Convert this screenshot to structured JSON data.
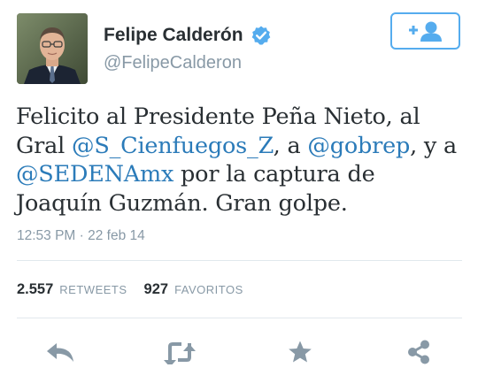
{
  "user": {
    "display_name": "Felipe Calderón",
    "handle": "@FelipeCalderon",
    "verified_icon": "verified-badge-icon"
  },
  "follow_button": {
    "icon": "add-user-icon",
    "label": "+"
  },
  "tweet": {
    "segments": [
      {
        "type": "text",
        "value": "Felicito al Presidente Peña Nieto, al Gral "
      },
      {
        "type": "mention",
        "value": "@S_Cienfuegos_Z"
      },
      {
        "type": "text",
        "value": ", a "
      },
      {
        "type": "mention",
        "value": "@gobrep"
      },
      {
        "type": "text",
        "value": ", y a "
      },
      {
        "type": "mention",
        "value": "@SEDENAmx"
      },
      {
        "type": "text",
        "value": " por la captura de Joaquín Guzmán. Gran golpe."
      }
    ],
    "timestamp": "12:53 PM · 22 feb 14"
  },
  "stats": {
    "retweets_count": "2.557",
    "retweets_label": "RETWEETS",
    "favorites_count": "927",
    "favorites_label": "FAVORITOS"
  },
  "actions": {
    "reply_icon": "reply-icon",
    "retweet_icon": "retweet-icon",
    "favorite_icon": "star-icon",
    "share_icon": "share-icon"
  },
  "colors": {
    "link": "#2b7bb9",
    "accent": "#55acee",
    "muted": "#8899a6",
    "text": "#292f33",
    "action_icon": "#8899a6"
  }
}
